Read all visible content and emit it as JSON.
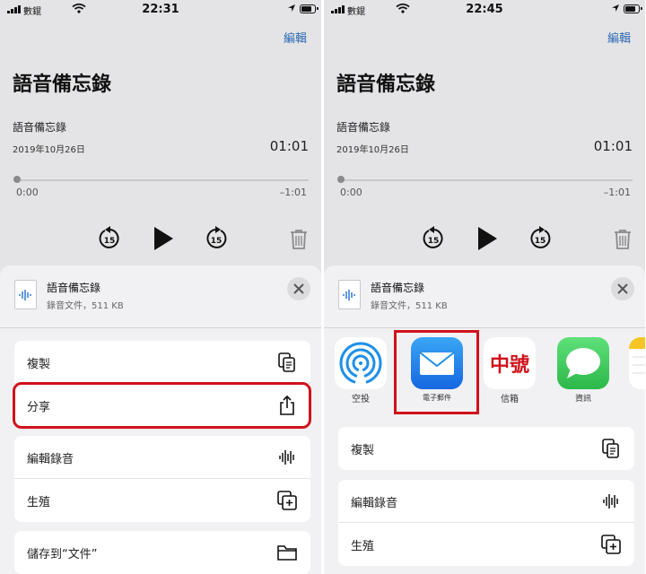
{
  "left": {
    "status": {
      "carrier": "數錕",
      "time": "22:31"
    },
    "header": {
      "edit": "編輯",
      "title": "語音備忘錄"
    },
    "recording": {
      "name": "語音備忘錄",
      "date": "2019年10月26日",
      "duration": "01:01",
      "start": "0:00",
      "end": "–1:01",
      "skip_back": "15",
      "skip_fwd": "15",
      "progress": 0
    },
    "sheet": {
      "file_title": "語音備忘錄",
      "file_sub": "錄音文件，511 KB",
      "actions": [
        {
          "label": "複製",
          "icon": "copy-icon"
        },
        {
          "label": "分享",
          "icon": "share-icon"
        },
        {
          "label": "編輯錄音",
          "icon": "waveform-icon"
        },
        {
          "label": "生殖",
          "icon": "duplicate-icon"
        },
        {
          "label": "儲存到“文件”",
          "icon": "folder-icon"
        }
      ]
    }
  },
  "right": {
    "status": {
      "carrier": "數錕",
      "time": "22:45"
    },
    "header": {
      "edit": "編輯",
      "title": "語音備忘錄"
    },
    "recording": {
      "name": "語音備忘錄",
      "date": "2019年10月26日",
      "duration": "01:01",
      "start": "0:00",
      "end": "–1:01",
      "skip_back": "15",
      "skip_fwd": "15",
      "progress": 0
    },
    "sheet": {
      "file_title": "語音備忘錄",
      "file_sub": "錄音文件，511 KB",
      "apps": [
        {
          "label": "空投",
          "icon": "airdrop-icon"
        },
        {
          "label": "電子郵件",
          "icon": "mail-icon"
        },
        {
          "label": "信箱",
          "icon": "zhonghao-app-icon",
          "icon_text": "中號"
        },
        {
          "label": "資訊",
          "icon": "messages-icon"
        }
      ],
      "actions": [
        {
          "label": "複製",
          "icon": "copy-icon"
        },
        {
          "label": "編輯錄音",
          "icon": "waveform-icon"
        },
        {
          "label": "生殖",
          "icon": "duplicate-icon"
        }
      ]
    }
  },
  "colors": {
    "accent": "#2e6bb5",
    "highlight": "#d0121b",
    "mail": "#1e8fe8",
    "messages": "#35c759"
  }
}
